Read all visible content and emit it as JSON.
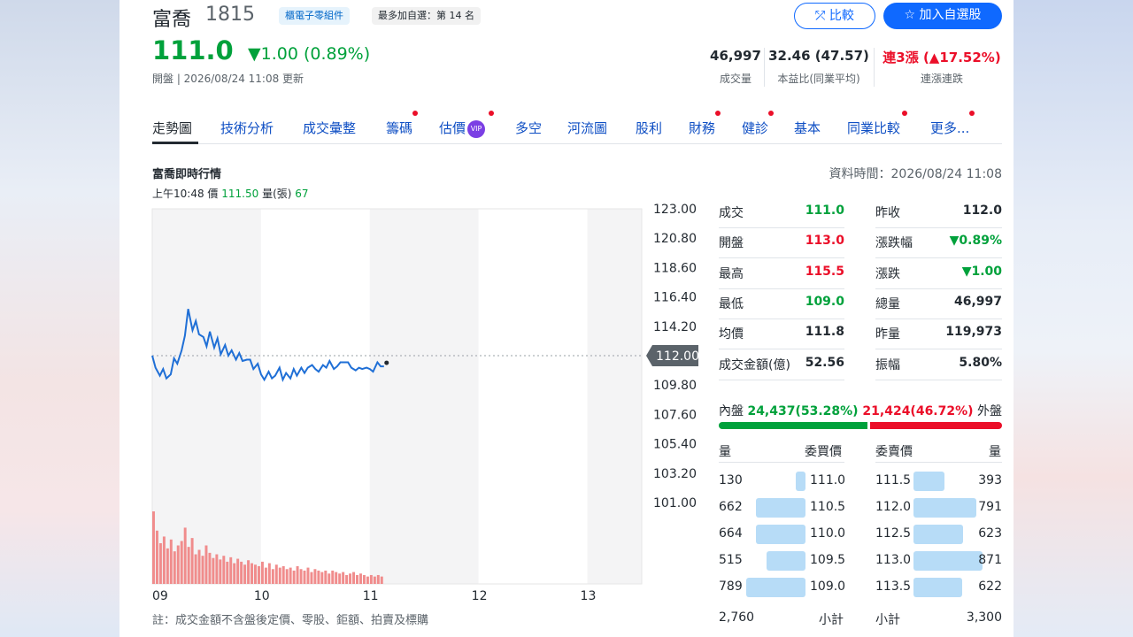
{
  "header": {
    "name": "富喬",
    "code": "1815",
    "tag_industry": "櫃電子零組件",
    "tag_rank": "最多加自選：第 14 名",
    "compare_label": "比較",
    "add_label": "加入自選股",
    "price": "111.0",
    "change": "▼1.00 (0.89%)",
    "market_status": "開盤 | 2026/08/24 11:08 更新"
  },
  "stats": [
    {
      "value": "46,997",
      "label": "成交量"
    },
    {
      "value": "32.46 (47.57)",
      "label": "本益比(同業平均)"
    },
    {
      "value": "連3漲 (▲17.52%)",
      "label": "連漲連跌"
    }
  ],
  "tabs": [
    "走勢圖",
    "技術分析",
    "成交彙整",
    "籌碼",
    "估價",
    "多空",
    "河流圖",
    "股利",
    "財務",
    "健診",
    "基本",
    "同業比較",
    "更多..."
  ],
  "vip_label": "VIP",
  "section": {
    "title": "富喬即時行情",
    "data_time": "資料時間：2026/08/24 11:08",
    "hover_time": "上午10:48",
    "hover_price_label": "價",
    "hover_price": "111.50",
    "hover_vol_label": "量(張)",
    "hover_vol": "67"
  },
  "chart_data": {
    "type": "line",
    "x_ticks": [
      "09",
      "10",
      "11",
      "12",
      "13"
    ],
    "y_ticks": [
      "123.00",
      "120.80",
      "118.60",
      "116.40",
      "114.20",
      "112.00",
      "109.80",
      "107.60",
      "105.40",
      "103.20",
      "101.00"
    ],
    "ylim": [
      101.0,
      123.0
    ],
    "reference_price": 112.0,
    "reference_label": "112.00",
    "colors": {
      "line": "#1f6fd6",
      "volume": "#f08c8c",
      "reference_tag": "#5b636a"
    },
    "price_series": [
      [
        9.0,
        112.0
      ],
      [
        9.03,
        111.1
      ],
      [
        9.07,
        110.5
      ],
      [
        9.1,
        111.0
      ],
      [
        9.13,
        110.3
      ],
      [
        9.17,
        110.6
      ],
      [
        9.2,
        111.8
      ],
      [
        9.23,
        111.4
      ],
      [
        9.27,
        112.4
      ],
      [
        9.3,
        113.5
      ],
      [
        9.33,
        115.5
      ],
      [
        9.37,
        113.9
      ],
      [
        9.4,
        114.6
      ],
      [
        9.43,
        113.6
      ],
      [
        9.47,
        113.4
      ],
      [
        9.5,
        112.7
      ],
      [
        9.53,
        113.8
      ],
      [
        9.57,
        112.6
      ],
      [
        9.6,
        113.3
      ],
      [
        9.63,
        112.1
      ],
      [
        9.67,
        112.8
      ],
      [
        9.7,
        112.0
      ],
      [
        9.73,
        112.4
      ],
      [
        9.77,
        111.7
      ],
      [
        9.8,
        112.2
      ],
      [
        9.83,
        111.6
      ],
      [
        9.87,
        111.7
      ],
      [
        9.9,
        111.7
      ],
      [
        9.93,
        111.0
      ],
      [
        9.97,
        111.4
      ],
      [
        10.0,
        110.6
      ],
      [
        10.03,
        110.2
      ],
      [
        10.07,
        110.8
      ],
      [
        10.1,
        110.3
      ],
      [
        10.13,
        110.5
      ],
      [
        10.17,
        111.1
      ],
      [
        10.2,
        110.2
      ],
      [
        10.23,
        110.7
      ],
      [
        10.27,
        110.3
      ],
      [
        10.3,
        111.0
      ],
      [
        10.33,
        110.5
      ],
      [
        10.37,
        111.1
      ],
      [
        10.4,
        110.7
      ],
      [
        10.43,
        111.1
      ],
      [
        10.47,
        111.3
      ],
      [
        10.5,
        111.0
      ],
      [
        10.53,
        110.8
      ],
      [
        10.57,
        111.3
      ],
      [
        10.6,
        111.1
      ],
      [
        10.63,
        111.6
      ],
      [
        10.67,
        111.0
      ],
      [
        10.7,
        111.2
      ],
      [
        10.73,
        111.5
      ],
      [
        10.77,
        111.5
      ],
      [
        10.8,
        111.5
      ],
      [
        10.83,
        111.1
      ],
      [
        10.87,
        110.9
      ],
      [
        10.9,
        111.1
      ],
      [
        10.93,
        111.0
      ],
      [
        10.97,
        111.1
      ],
      [
        11.0,
        111.0
      ],
      [
        11.03,
        110.8
      ],
      [
        11.07,
        111.5
      ],
      [
        11.1,
        111.2
      ],
      [
        11.13,
        111.2
      ]
    ],
    "volume_series": [
      98,
      72,
      55,
      64,
      48,
      60,
      44,
      52,
      58,
      76,
      50,
      62,
      40,
      46,
      38,
      52,
      42,
      35,
      40,
      33,
      38,
      30,
      36,
      28,
      34,
      30,
      26,
      32,
      28,
      26,
      24,
      30,
      22,
      28,
      20,
      26,
      22,
      24,
      20,
      22,
      18,
      24,
      20,
      18,
      22,
      16,
      20,
      18,
      16,
      18,
      14,
      18,
      16,
      14,
      16,
      12,
      14,
      16,
      12,
      14,
      12,
      10,
      12,
      10,
      12,
      10
    ]
  },
  "quotes": {
    "left": [
      {
        "label": "成交",
        "value": "111.0",
        "color": "green"
      },
      {
        "label": "開盤",
        "value": "113.0",
        "color": "red"
      },
      {
        "label": "最高",
        "value": "115.5",
        "color": "red"
      },
      {
        "label": "最低",
        "value": "109.0",
        "color": "green"
      },
      {
        "label": "均價",
        "value": "111.8",
        "color": "black"
      },
      {
        "label": "成交金額(億)",
        "value": "52.56",
        "color": "black"
      }
    ],
    "right": [
      {
        "label": "昨收",
        "value": "112.0",
        "color": "black"
      },
      {
        "label": "漲跌幅",
        "value": "▼0.89%",
        "color": "green"
      },
      {
        "label": "漲跌",
        "value": "▼1.00",
        "color": "green"
      },
      {
        "label": "總量",
        "value": "46,997",
        "color": "black"
      },
      {
        "label": "昨量",
        "value": "119,973",
        "color": "black"
      },
      {
        "label": "振幅",
        "value": "5.80%",
        "color": "black"
      }
    ]
  },
  "inner_outer": {
    "inner_label": "內盤",
    "inner_value": "24,437(53.28%)",
    "outer_value": "21,424(46.72%)",
    "outer_label": "外盤",
    "inner_ratio": 0.5328
  },
  "orderbook": {
    "head_qty": "量",
    "head_bid": "委買價",
    "head_ask": "委賣價",
    "bids": [
      {
        "qty": "130",
        "price": "111.0",
        "ratio": 0.15
      },
      {
        "qty": "662",
        "price": "110.5",
        "ratio": 0.76
      },
      {
        "qty": "664",
        "price": "110.0",
        "ratio": 0.76
      },
      {
        "qty": "515",
        "price": "109.5",
        "ratio": 0.59
      },
      {
        "qty": "789",
        "price": "109.0",
        "ratio": 0.91
      }
    ],
    "asks": [
      {
        "price": "111.5",
        "qty": "393",
        "ratio": 0.45
      },
      {
        "price": "112.0",
        "qty": "791",
        "ratio": 0.91
      },
      {
        "price": "112.5",
        "qty": "623",
        "ratio": 0.72
      },
      {
        "price": "113.0",
        "qty": "871",
        "ratio": 1.0
      },
      {
        "price": "113.5",
        "qty": "622",
        "ratio": 0.71
      }
    ],
    "bid_total": "2,760",
    "subtotal_label": "小計",
    "ask_total": "3,300"
  },
  "footnote": "註：成交金額不含盤後定價、零股、鉅額、拍賣及標購"
}
